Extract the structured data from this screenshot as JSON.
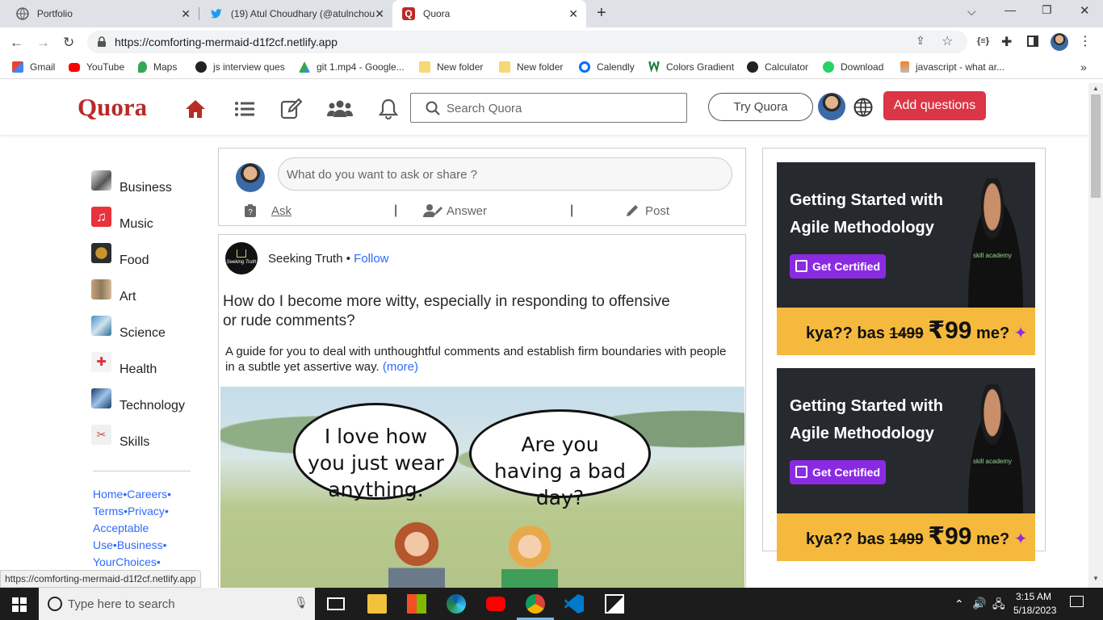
{
  "browser": {
    "tabs": [
      {
        "title": "Portfolio",
        "icon": "globe-icon"
      },
      {
        "title": "(19) Atul Choudhary (@atulnchou",
        "icon": "twitter-icon"
      },
      {
        "title": "Quora",
        "icon": "quora-icon"
      }
    ],
    "url": "https://comforting-mermaid-d1f2cf.netlify.app",
    "bookmarks": [
      "Gmail",
      "YouTube",
      "Maps",
      "js interview ques",
      "git 1.mp4 - Google...",
      "New folder",
      "New folder",
      "Calendly",
      "Colors Gradient",
      "Calculator",
      "Download",
      "javascript - what ar..."
    ],
    "status_url": "https://comforting-mermaid-d1f2cf.netlify.app"
  },
  "header": {
    "logo": "Quora",
    "search_placeholder": "Search Quora",
    "try_label": "Try Quora",
    "add_label": "Add questions",
    "brand_color": "#b92b27",
    "accent_color": "#dc3545"
  },
  "sidebar": {
    "items": [
      {
        "label": "Business",
        "icon": "business-icon"
      },
      {
        "label": "Music",
        "icon": "music-icon"
      },
      {
        "label": "Food",
        "icon": "food-icon"
      },
      {
        "label": "Art",
        "icon": "art-icon"
      },
      {
        "label": "Science",
        "icon": "science-icon"
      },
      {
        "label": "Health",
        "icon": "health-icon"
      },
      {
        "label": "Technology",
        "icon": "technology-icon"
      },
      {
        "label": "Skills",
        "icon": "skills-icon"
      }
    ],
    "footer_links": [
      "Home",
      "Careers",
      "Terms",
      "Privacy",
      "Acceptable Use",
      "Business",
      "YourChoices"
    ]
  },
  "ask": {
    "placeholder": "What do you want to ask or share ?",
    "ask_label": "Ask",
    "answer_label": "Answer",
    "post_label": "Post"
  },
  "post": {
    "author": "Seeking Truth",
    "logo_text": "Seeking Truth",
    "follow": "Follow",
    "title": "How do I become more witty, especially in responding to offensive or rude comments?",
    "description": "A guide for you to deal with unthoughtful comments and establish firm boundaries with people in a subtle yet assertive way.",
    "more": "(more)",
    "bubble_left": "I love how you just wear anything.",
    "bubble_right": "Are you having a bad day?"
  },
  "ads": [
    {
      "headline": "Getting Started with Agile Methodology",
      "cta": "Get Certified",
      "brand": "skill academy",
      "price_text": "kya?? bas",
      "old_price": "1499",
      "new_price": "₹99",
      "suffix": "me?"
    },
    {
      "headline": "Getting Started with Agile Methodology",
      "cta": "Get Certified",
      "brand": "skill academy",
      "price_text": "kya?? bas",
      "old_price": "1499",
      "new_price": "₹99",
      "suffix": "me?"
    }
  ],
  "taskbar": {
    "search_placeholder": "Type here to search",
    "time": "3:15 AM",
    "date": "5/18/2023"
  }
}
